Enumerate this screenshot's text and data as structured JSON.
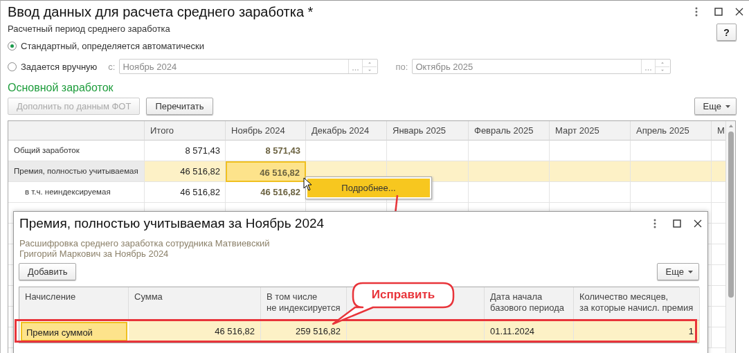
{
  "window": {
    "title": "Ввод данных для расчета среднего заработка *"
  },
  "help_button": "?",
  "period": {
    "label": "Расчетный период среднего заработка",
    "options": [
      {
        "label": "Стандартный, определяется автоматически",
        "selected": true
      },
      {
        "label": "Задается вручную",
        "selected": false
      }
    ],
    "from": {
      "prefix": "с:",
      "value": "Ноябрь 2024",
      "disabled": true
    },
    "to": {
      "prefix": "по:",
      "value": "Октябрь 2025",
      "disabled": true
    }
  },
  "section_title": "Основной заработок",
  "buttons": [
    {
      "label": "Дополнить по данным ФОТ",
      "disabled": true
    },
    {
      "label": "Перечитать",
      "disabled": false
    }
  ],
  "more_button": "Еще",
  "table": {
    "columns": [
      "Итого",
      "Ноябрь 2024",
      "Декабрь 2024",
      "Январь 2025",
      "Февраль 2025",
      "Март 2025",
      "Апрель 2025",
      "М"
    ],
    "rows": [
      {
        "label": "Общий заработок",
        "total": "8 571,43",
        "selected": false,
        "cells": [
          {
            "text": "8 571,43",
            "selected": false
          }
        ]
      },
      {
        "label": "Премия, полностью учитываемая",
        "total": "46 516,82",
        "selected": true,
        "cells": [
          {
            "text": "46 516,82",
            "selected": true
          }
        ],
        "children": [
          {
            "label": "в т.ч. неиндексируемая",
            "total": "46 516,82",
            "selected": false,
            "cells": [
              {
                "text": "46 516,82",
                "selected": false
              }
            ]
          }
        ]
      }
    ]
  },
  "context_menu": {
    "items": [
      {
        "label": "Подробнее...",
        "selected": true
      }
    ]
  },
  "dialog": {
    "title": "Премия, полностью учитываемая за Ноябрь 2024",
    "description": "Расшифровка среднего заработка сотрудника Матвиевский\nГригорий Маркович за Ноябрь 2024",
    "add_button": "Добавить",
    "more_button": "Еще",
    "table": {
      "columns": {
        "accrual": "Начисление",
        "amount": "Сумма",
        "non_indexed": "В том числе\nне индексируется",
        "start_date": "Дата начала\nбазового периода",
        "months": "Количество месяцев,\nза которые начисл. премия"
      },
      "rows": [
        {
          "accrual": "Премия суммой",
          "amount": "46 516,82",
          "non_indexed": "259 516,82",
          "start_date": "01.11.2024",
          "months": "1",
          "selected": true
        }
      ]
    }
  },
  "annotation": {
    "label": "Исправить"
  }
}
